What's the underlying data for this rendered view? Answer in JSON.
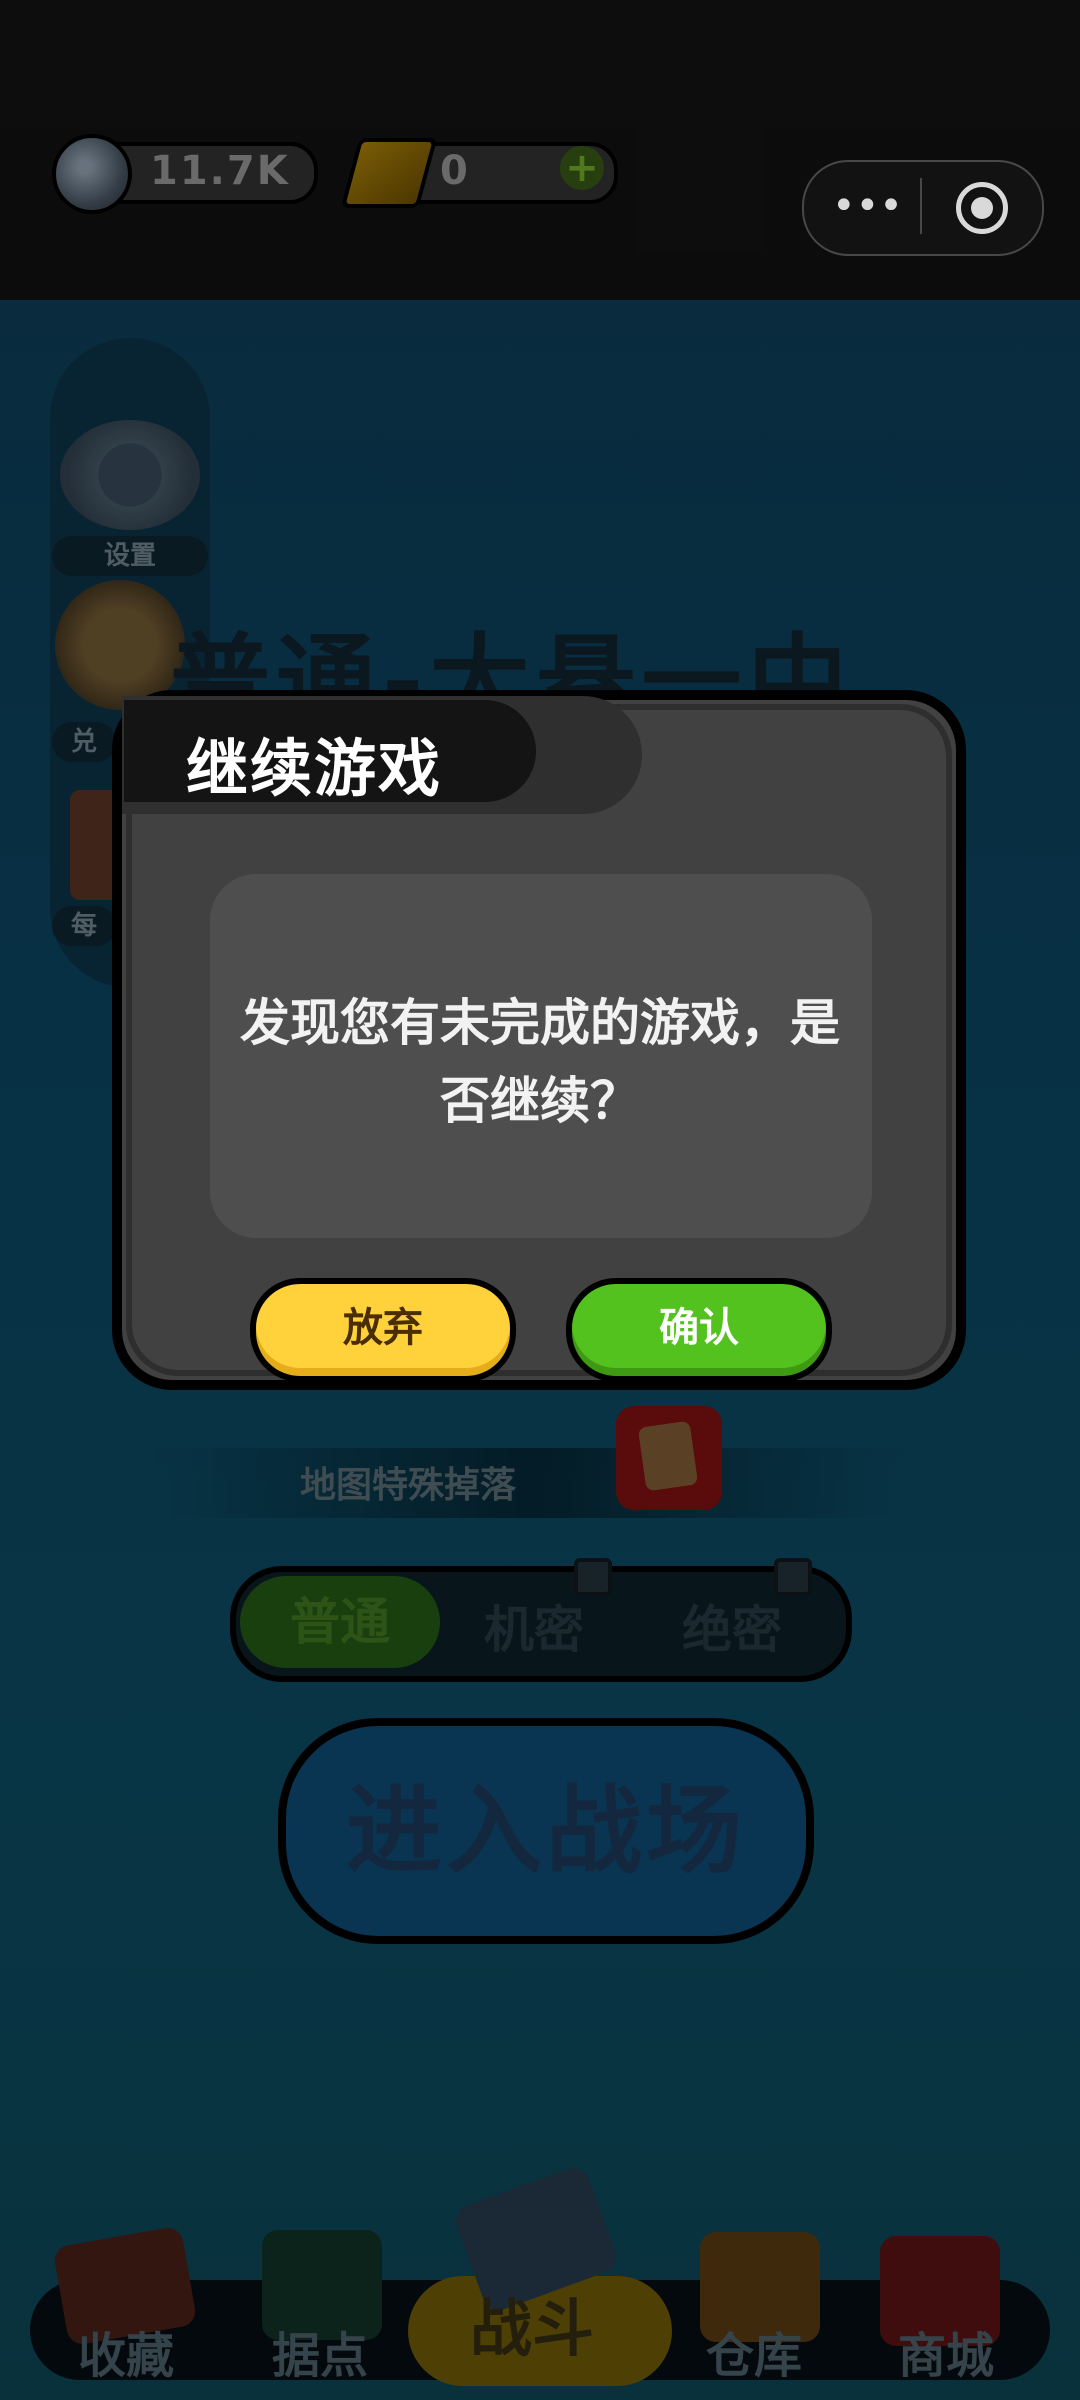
{
  "top_bar": {
    "coin_value": "11.7K",
    "gold_value": "0",
    "gold_add": "+",
    "capsule_more": "•••"
  },
  "side_menu": {
    "settings": "设置",
    "exchange": "兑",
    "daily": "每"
  },
  "map_title": "普通-大悬一中",
  "drops_label": "地图特殊掉落",
  "difficulty_tabs": [
    "普通",
    "机密",
    "绝密"
  ],
  "enter_button": "进入战场",
  "bottom_nav": {
    "collect": "收藏",
    "base": "据点",
    "battle": "战斗",
    "storage": "仓库",
    "shop": "商城"
  },
  "modal": {
    "title": "继续游戏",
    "message": "发现您有未完成的游戏，是否继续？",
    "abandon": "放弃",
    "confirm": "确认"
  },
  "colors": {
    "confirm_green": "#54c21e",
    "abandon_yellow": "#ffd23c",
    "modal_bg": "#414141"
  }
}
